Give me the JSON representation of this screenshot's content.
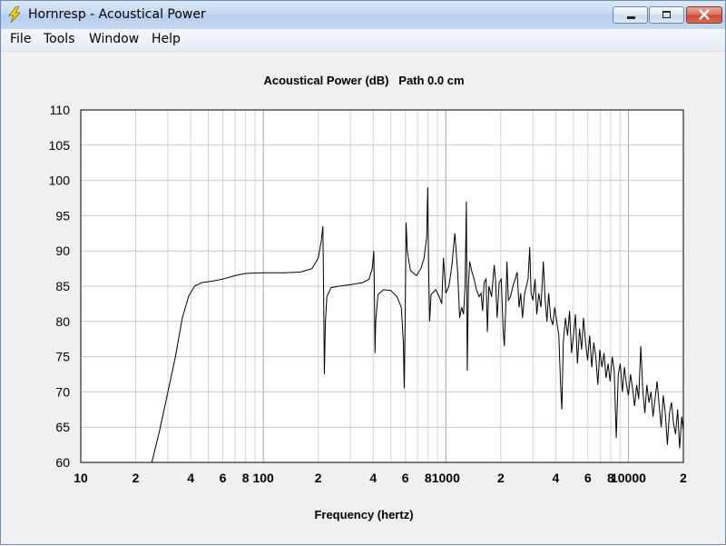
{
  "window": {
    "title": "Hornresp - Acoustical Power",
    "icon": "lightning-bolt-icon",
    "controls": [
      "minimize-icon",
      "maximize-icon",
      "close-icon"
    ]
  },
  "menu": {
    "items": [
      {
        "label": "File"
      },
      {
        "label": "Tools"
      },
      {
        "label": "Window"
      },
      {
        "label": "Help"
      }
    ]
  },
  "chart_data": {
    "type": "line",
    "title": "Acoustical Power (dB)   Path 0.0 cm",
    "xlabel": "Frequency (hertz)",
    "ylabel": "",
    "x_scale": "log",
    "xlim": [
      10,
      20000
    ],
    "ylim": [
      60,
      110
    ],
    "grid": true,
    "yticks": [
      "110",
      "105",
      "100",
      "95",
      "90",
      "85",
      "80",
      "75",
      "70",
      "65",
      "60"
    ],
    "xticks": [
      {
        "value": 10,
        "label": "10"
      },
      {
        "value": 20,
        "label": "2"
      },
      {
        "value": 40,
        "label": "4"
      },
      {
        "value": 60,
        "label": "6"
      },
      {
        "value": 80,
        "label": "8"
      },
      {
        "value": 100,
        "label": "100"
      },
      {
        "value": 200,
        "label": "2"
      },
      {
        "value": 400,
        "label": "4"
      },
      {
        "value": 600,
        "label": "6"
      },
      {
        "value": 800,
        "label": "8"
      },
      {
        "value": 1000,
        "label": "1000"
      },
      {
        "value": 2000,
        "label": "2"
      },
      {
        "value": 4000,
        "label": "4"
      },
      {
        "value": 6000,
        "label": "6"
      },
      {
        "value": 8000,
        "label": "8"
      },
      {
        "value": 10000,
        "label": "10000"
      },
      {
        "value": 20000,
        "label": "2"
      }
    ],
    "series": [
      {
        "color": "#000000",
        "points": [
          [
            24.5,
            60.0
          ],
          [
            27,
            64.5
          ],
          [
            30,
            70.0
          ],
          [
            33,
            75.0
          ],
          [
            36,
            80.5
          ],
          [
            39,
            83.6
          ],
          [
            42,
            85.0
          ],
          [
            46,
            85.5
          ],
          [
            52,
            85.7
          ],
          [
            60,
            86.0
          ],
          [
            70,
            86.5
          ],
          [
            80,
            86.8
          ],
          [
            100,
            86.9
          ],
          [
            130,
            86.9
          ],
          [
            160,
            87.0
          ],
          [
            185,
            87.5
          ],
          [
            200,
            89.0
          ],
          [
            208,
            91.5
          ],
          [
            212,
            93.5
          ],
          [
            214,
            84.0
          ],
          [
            216,
            72.5
          ],
          [
            219,
            80.0
          ],
          [
            223,
            83.5
          ],
          [
            235,
            84.8
          ],
          [
            260,
            85.0
          ],
          [
            300,
            85.2
          ],
          [
            350,
            85.5
          ],
          [
            380,
            86.0
          ],
          [
            395,
            87.5
          ],
          [
            403,
            90.0
          ],
          [
            406,
            84.0
          ],
          [
            409,
            75.5
          ],
          [
            413,
            80.0
          ],
          [
            425,
            83.8
          ],
          [
            455,
            84.5
          ],
          [
            500,
            84.4
          ],
          [
            540,
            83.5
          ],
          [
            570,
            82.0
          ],
          [
            585,
            77.0
          ],
          [
            591,
            70.5
          ],
          [
            598,
            80.0
          ],
          [
            606,
            94.0
          ],
          [
            615,
            90.0
          ],
          [
            640,
            87.2
          ],
          [
            690,
            86.5
          ],
          [
            730,
            87.5
          ],
          [
            760,
            89.0
          ],
          [
            785,
            92.0
          ],
          [
            795,
            99.0
          ],
          [
            805,
            88.0
          ],
          [
            815,
            80.0
          ],
          [
            830,
            83.8
          ],
          [
            880,
            84.5
          ],
          [
            920,
            83.5
          ],
          [
            950,
            82.5
          ],
          [
            970,
            89.0
          ],
          [
            985,
            86.5
          ],
          [
            1000,
            84.0
          ],
          [
            1040,
            85.0
          ],
          [
            1080,
            88.0
          ],
          [
            1120,
            92.5
          ],
          [
            1160,
            87.0
          ],
          [
            1190,
            80.5
          ],
          [
            1220,
            82.0
          ],
          [
            1250,
            81.0
          ],
          [
            1275,
            85.0
          ],
          [
            1295,
            97.0
          ],
          [
            1310,
            73.0
          ],
          [
            1330,
            85.0
          ],
          [
            1350,
            88.5
          ],
          [
            1390,
            87.0
          ],
          [
            1430,
            86.0
          ],
          [
            1470,
            84.5
          ],
          [
            1520,
            83.5
          ],
          [
            1560,
            84.0
          ],
          [
            1590,
            81.5
          ],
          [
            1620,
            85.5
          ],
          [
            1660,
            86.0
          ],
          [
            1690,
            78.5
          ],
          [
            1720,
            85.0
          ],
          [
            1780,
            83.5
          ],
          [
            1840,
            88.0
          ],
          [
            1870,
            86.0
          ],
          [
            1910,
            80.5
          ],
          [
            1960,
            85.5
          ],
          [
            2010,
            86.0
          ],
          [
            2060,
            79.0
          ],
          [
            2090,
            76.5
          ],
          [
            2130,
            82.5
          ],
          [
            2160,
            88.5
          ],
          [
            2200,
            83.0
          ],
          [
            2260,
            83.5
          ],
          [
            2330,
            85.0
          ],
          [
            2400,
            86.0
          ],
          [
            2460,
            87.0
          ],
          [
            2520,
            82.0
          ],
          [
            2570,
            84.0
          ],
          [
            2630,
            80.5
          ],
          [
            2700,
            84.0
          ],
          [
            2760,
            85.0
          ],
          [
            2820,
            86.0
          ],
          [
            2880,
            90.5
          ],
          [
            2930,
            84.0
          ],
          [
            3000,
            83.0
          ],
          [
            3080,
            86.0
          ],
          [
            3150,
            81.0
          ],
          [
            3230,
            84.0
          ],
          [
            3320,
            82.0
          ],
          [
            3420,
            88.5
          ],
          [
            3500,
            83.0
          ],
          [
            3580,
            80.0
          ],
          [
            3660,
            84.0
          ],
          [
            3750,
            80.5
          ],
          [
            3850,
            79.5
          ],
          [
            3950,
            82.0
          ],
          [
            4050,
            80.0
          ],
          [
            4160,
            78.0
          ],
          [
            4250,
            71.0
          ],
          [
            4320,
            67.5
          ],
          [
            4400,
            77.0
          ],
          [
            4520,
            80.5
          ],
          [
            4640,
            78.0
          ],
          [
            4760,
            81.5
          ],
          [
            4880,
            75.5
          ],
          [
            5000,
            78.0
          ],
          [
            5130,
            81.0
          ],
          [
            5260,
            74.0
          ],
          [
            5400,
            79.0
          ],
          [
            5540,
            76.0
          ],
          [
            5680,
            80.5
          ],
          [
            5830,
            77.0
          ],
          [
            5980,
            74.5
          ],
          [
            6140,
            78.0
          ],
          [
            6300,
            73.5
          ],
          [
            6460,
            77.0
          ],
          [
            6630,
            75.0
          ],
          [
            6800,
            71.0
          ],
          [
            6980,
            76.0
          ],
          [
            7160,
            73.5
          ],
          [
            7350,
            75.5
          ],
          [
            7540,
            72.0
          ],
          [
            7740,
            74.0
          ],
          [
            7940,
            71.5
          ],
          [
            8150,
            75.0
          ],
          [
            8360,
            73.0
          ],
          [
            8580,
            63.5
          ],
          [
            8800,
            72.5
          ],
          [
            9030,
            74.0
          ],
          [
            9270,
            70.0
          ],
          [
            9510,
            73.5
          ],
          [
            9760,
            71.0
          ],
          [
            10010,
            69.5
          ],
          [
            10270,
            72.5
          ],
          [
            10540,
            70.5
          ],
          [
            10820,
            68.0
          ],
          [
            11100,
            71.0
          ],
          [
            11390,
            69.0
          ],
          [
            11690,
            76.5
          ],
          [
            12000,
            70.0
          ],
          [
            12310,
            67.0
          ],
          [
            12630,
            71.0
          ],
          [
            12960,
            68.5
          ],
          [
            13300,
            70.0
          ],
          [
            13650,
            66.5
          ],
          [
            14000,
            69.0
          ],
          [
            14370,
            71.5
          ],
          [
            14750,
            68.0
          ],
          [
            15130,
            65.0
          ],
          [
            15530,
            69.5
          ],
          [
            15930,
            67.0
          ],
          [
            16350,
            62.5
          ],
          [
            16780,
            67.0
          ],
          [
            17220,
            68.5
          ],
          [
            17670,
            65.5
          ],
          [
            18130,
            64.0
          ],
          [
            18600,
            67.5
          ],
          [
            19090,
            62.0
          ],
          [
            19590,
            66.5
          ],
          [
            20000,
            64.5
          ]
        ]
      }
    ]
  }
}
